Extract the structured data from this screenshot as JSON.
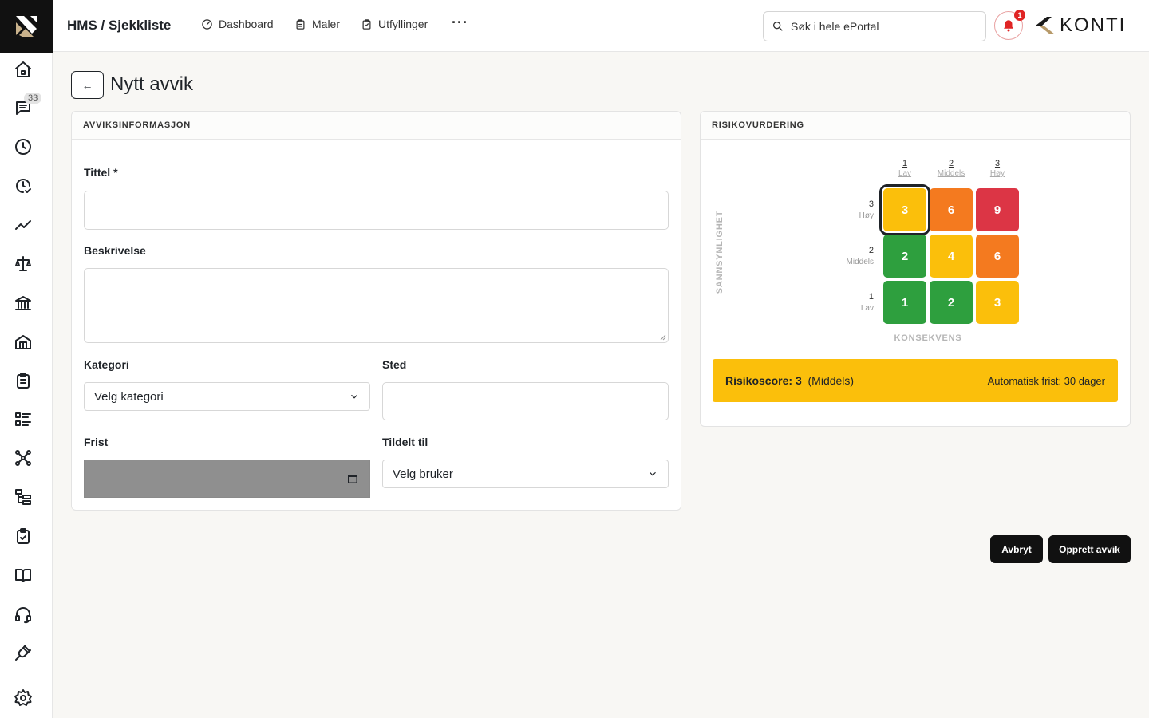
{
  "header": {
    "breadcrumb": "HMS / Sjekkliste",
    "nav": [
      {
        "label": "Dashboard",
        "icon": "gauge-icon"
      },
      {
        "label": "Maler",
        "icon": "clipboard-icon"
      },
      {
        "label": "Utfyllinger",
        "icon": "clipboard-list-icon"
      }
    ],
    "more_label": "···",
    "search_placeholder": "Søk i hele ePortal",
    "notification_count": "1",
    "brand": "KONTI"
  },
  "sidebar": {
    "items": [
      {
        "name": "home-icon"
      },
      {
        "name": "chat-icon",
        "badge": "33"
      },
      {
        "name": "clock-icon"
      },
      {
        "name": "clock-check-icon"
      },
      {
        "name": "trend-icon"
      },
      {
        "name": "scale-icon"
      },
      {
        "name": "bank-icon"
      },
      {
        "name": "building-icon"
      },
      {
        "name": "clipboard-icon"
      },
      {
        "name": "list-icon"
      },
      {
        "name": "network-icon"
      },
      {
        "name": "tree-icon"
      },
      {
        "name": "clipboard-check-icon"
      },
      {
        "name": "book-icon"
      },
      {
        "name": "headset-icon"
      },
      {
        "name": "plug-icon"
      },
      {
        "name": "settings-icon"
      }
    ]
  },
  "page": {
    "back_label": "←",
    "title": "Nytt avvik"
  },
  "form": {
    "section_title": "AVVIKSINFORMASJON",
    "title_label": "Tittel *",
    "title_value": "",
    "description_label": "Beskrivelse",
    "description_value": "",
    "category_label": "Kategori",
    "category_value": "Velg kategori",
    "location_label": "Sted",
    "location_value": "",
    "deadline_label": "Frist",
    "assigned_label": "Tildelt til",
    "assigned_value": "Velg bruker"
  },
  "risk": {
    "section_title": "RISIKOVURDERING",
    "y_axis_label": "SANNSYNLIGHET",
    "x_axis_label": "KONSEKVENS",
    "columns": [
      {
        "n": "1",
        "label": "Lav"
      },
      {
        "n": "2",
        "label": "Middels"
      },
      {
        "n": "3",
        "label": "Høy"
      }
    ],
    "rows": [
      {
        "n": "3",
        "label": "Høy",
        "cells": [
          "3",
          "6",
          "9"
        ]
      },
      {
        "n": "2",
        "label": "Middels",
        "cells": [
          "2",
          "4",
          "6"
        ]
      },
      {
        "n": "1",
        "label": "Lav",
        "cells": [
          "1",
          "2",
          "3"
        ]
      }
    ],
    "selected": {
      "row": 0,
      "col": 0
    },
    "colors": {
      "green": "#2e9f3e",
      "yellow": "#fbbf0b",
      "orange": "#f47a1f",
      "red": "#dc3545"
    },
    "score_label": "Risikoscore:",
    "score_value": "3",
    "score_level": "(Middels)",
    "auto_deadline": "Automatisk frist: 30 dager"
  },
  "actions": {
    "cancel": "Avbryt",
    "create": "Opprett avvik"
  }
}
